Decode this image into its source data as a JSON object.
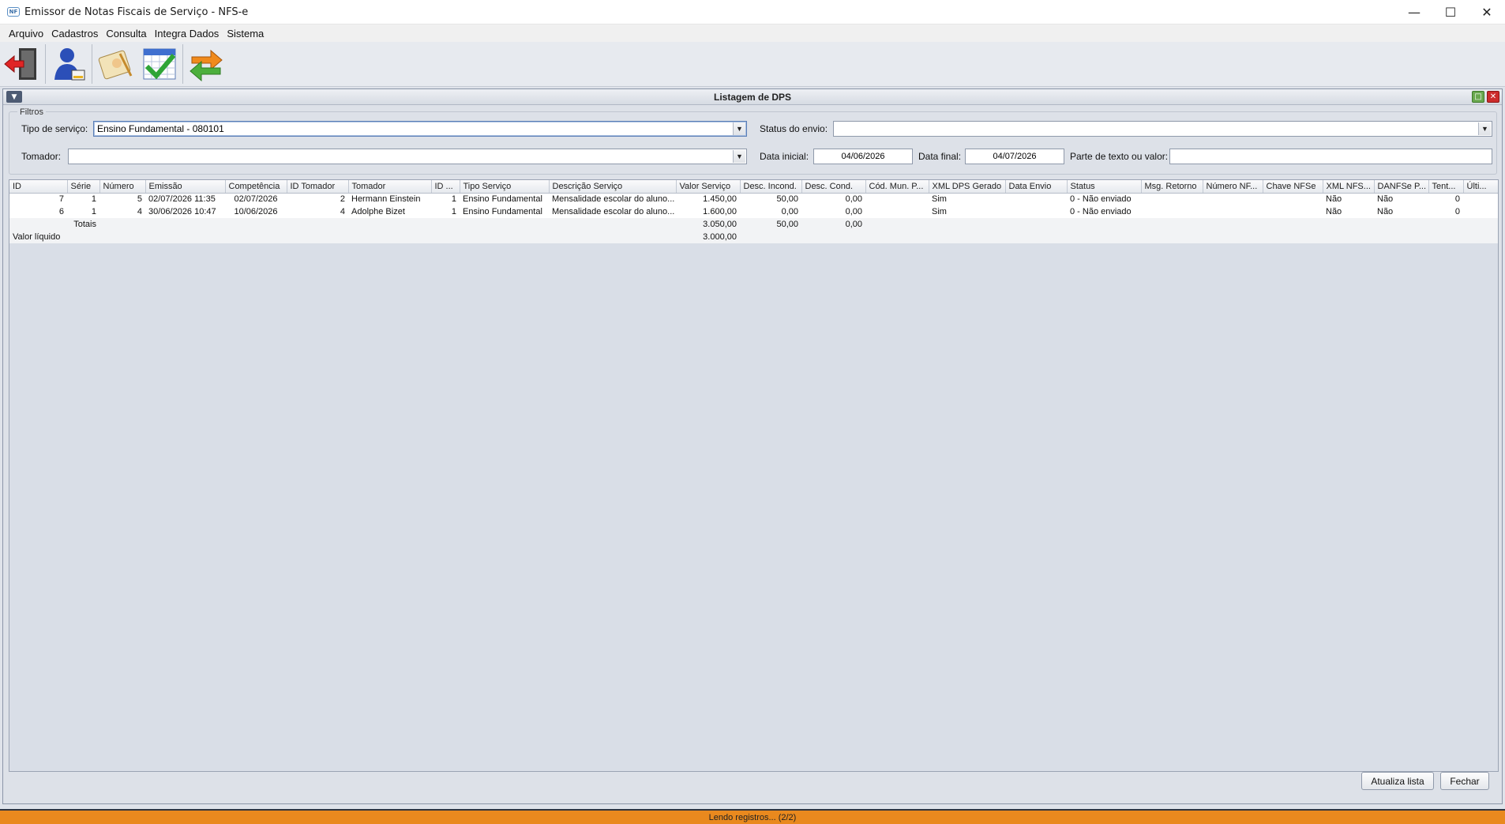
{
  "window": {
    "title": "Emissor de Notas Fiscais de Serviço - NFS-e",
    "minimize_icon": "minimize-icon",
    "maximize_icon": "maximize-icon",
    "close_icon": "close-icon"
  },
  "menu": {
    "items": [
      "Arquivo",
      "Cadastros",
      "Consulta",
      "Integra Dados",
      "Sistema"
    ]
  },
  "toolbar": {
    "buttons": [
      "exit-door-icon",
      "user-icon",
      "notepad-edit-icon",
      "calendar-check-icon",
      "sync-arrows-icon"
    ]
  },
  "frame": {
    "title": "Listagem de DPS"
  },
  "filters": {
    "legend": "Filtros",
    "tipo_servico_label": "Tipo de serviço:",
    "tipo_servico_value": "Ensino Fundamental - 080101",
    "status_envio_label": "Status do envio:",
    "status_envio_value": "",
    "tomador_label": "Tomador:",
    "tomador_value": "",
    "data_inicial_label": "Data inicial:",
    "data_inicial_value": "04/06/2026",
    "data_final_label": "Data final:",
    "data_final_value": "04/07/2026",
    "texto_label": "Parte de texto ou valor:",
    "texto_value": ""
  },
  "table": {
    "columns": [
      "ID",
      "Série",
      "Número",
      "Emissão",
      "Competência",
      "ID Tomador",
      "Tomador",
      "ID ...",
      "Tipo Serviço",
      "Descrição Serviço",
      "Valor Serviço",
      "Desc. Incond.",
      "Desc. Cond.",
      "Cód. Mun. P...",
      "XML DPS Gerado",
      "Data Envio",
      "Status",
      "Msg. Retorno",
      "Número NF...",
      "Chave NFSe",
      "XML NFS...",
      "DANFSe P...",
      "Tent...",
      "Últi..."
    ],
    "rows": [
      [
        "7",
        "1",
        "5",
        "02/07/2026 11:35",
        "02/07/2026",
        "2",
        "Hermann Einstein",
        "1",
        "Ensino Fundamental",
        "Mensalidade escolar do aluno...",
        "1.450,00",
        "50,00",
        "0,00",
        "",
        "Sim",
        "",
        "0 - Não enviado",
        "",
        "",
        "",
        "Não",
        "Não",
        "0",
        ""
      ],
      [
        "6",
        "1",
        "4",
        "30/06/2026 10:47",
        "10/06/2026",
        "4",
        "Adolphe Bizet",
        "1",
        "Ensino Fundamental",
        "Mensalidade escolar do aluno...",
        "1.600,00",
        "0,00",
        "0,00",
        "",
        "Sim",
        "",
        "0 - Não enviado",
        "",
        "",
        "",
        "Não",
        "Não",
        "0",
        ""
      ]
    ],
    "totals": {
      "label": "Totais",
      "valor_servico": "3.050,00",
      "desc_incond": "50,00",
      "desc_cond": "0,00"
    },
    "liquido": {
      "label": "Valor líquido",
      "valor": "3.000,00"
    }
  },
  "buttons": {
    "atualiza": "Atualiza lista",
    "fechar": "Fechar"
  },
  "status": {
    "text": "Lendo registros... (2/2)"
  },
  "colors": {
    "status_bar": "#e9891e",
    "close_button": "#cc2c2c",
    "maximize_button": "#6aa84f"
  }
}
